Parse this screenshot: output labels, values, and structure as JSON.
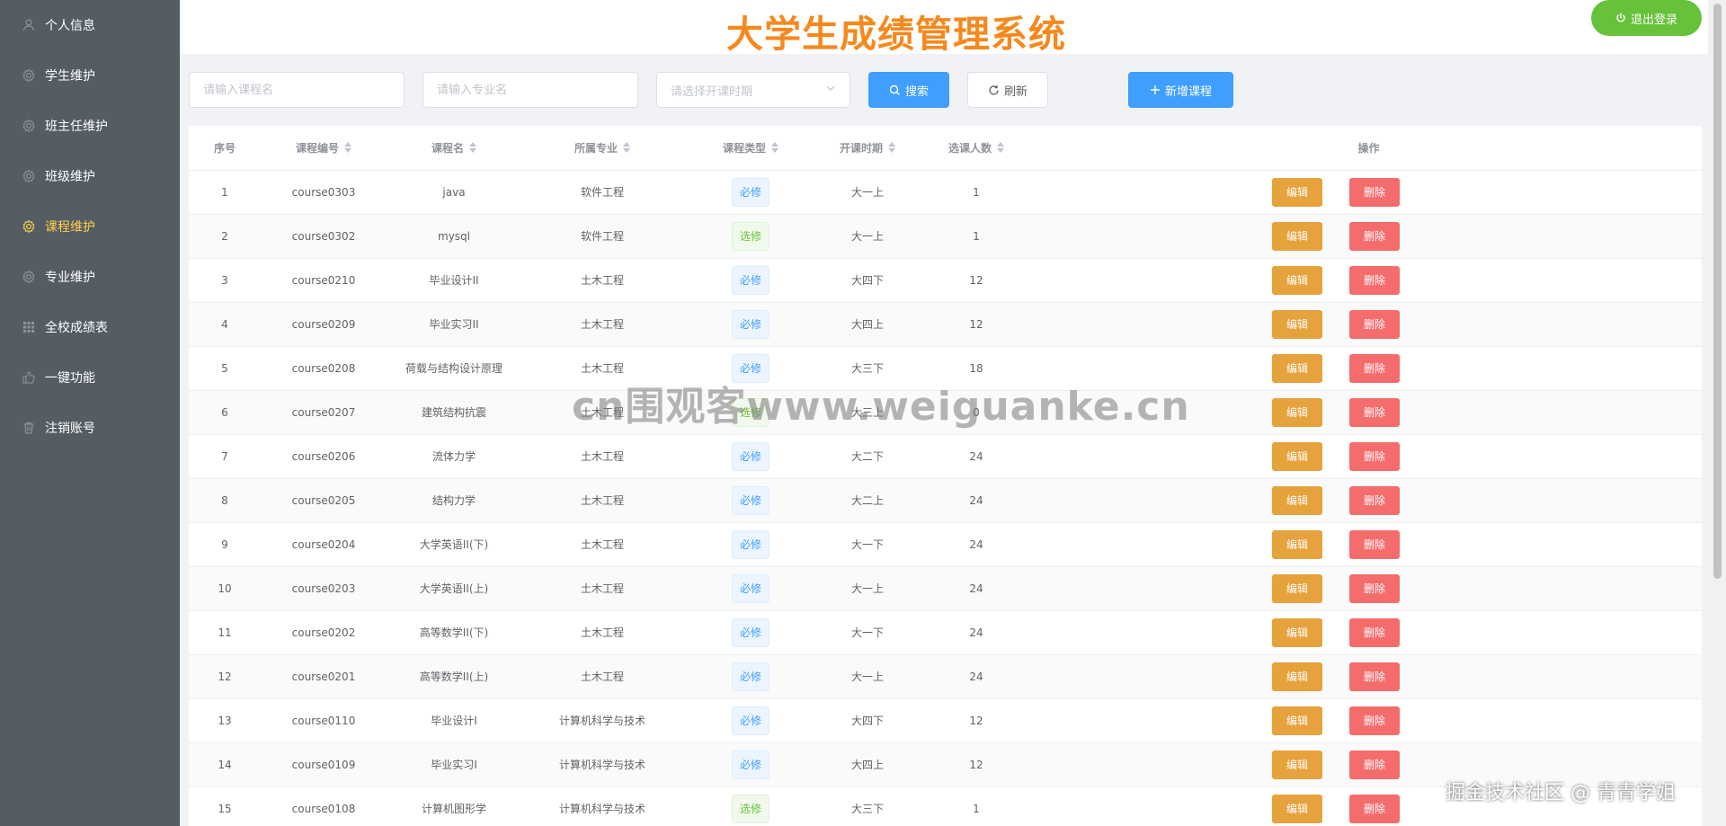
{
  "sidebar": {
    "items": [
      {
        "label": "个人信息",
        "icon": "user-icon"
      },
      {
        "label": "学生维护",
        "icon": "gear-icon"
      },
      {
        "label": "班主任维护",
        "icon": "gear-icon"
      },
      {
        "label": "班级维护",
        "icon": "gear-icon"
      },
      {
        "label": "课程维护",
        "icon": "gear-icon",
        "active": true
      },
      {
        "label": "专业维护",
        "icon": "gear-icon"
      },
      {
        "label": "全校成绩表",
        "icon": "grid-icon"
      },
      {
        "label": "一键功能",
        "icon": "thumb-icon"
      },
      {
        "label": "注销账号",
        "icon": "trash-icon"
      }
    ]
  },
  "header": {
    "title": "大学生成绩管理系统",
    "logout_label": "退出登录"
  },
  "toolbar": {
    "course_placeholder": "请输入课程名",
    "major_placeholder": "请输入专业名",
    "period_placeholder": "请选择开课时期",
    "search_label": "搜索",
    "refresh_label": "刷新",
    "add_label": "新增课程"
  },
  "table": {
    "headers": [
      "序号",
      "课程编号",
      "课程名",
      "所属专业",
      "课程类型",
      "开课时期",
      "选课人数",
      "操作"
    ],
    "edit_label": "编辑",
    "delete_label": "删除",
    "rows": [
      {
        "no": "1",
        "code": "course0303",
        "name": "java",
        "major": "软件工程",
        "type": "必修",
        "period": "大一上",
        "count": "1"
      },
      {
        "no": "2",
        "code": "course0302",
        "name": "mysql",
        "major": "软件工程",
        "type": "选修",
        "period": "大一上",
        "count": "1"
      },
      {
        "no": "3",
        "code": "course0210",
        "name": "毕业设计II",
        "major": "土木工程",
        "type": "必修",
        "period": "大四下",
        "count": "12"
      },
      {
        "no": "4",
        "code": "course0209",
        "name": "毕业实习II",
        "major": "土木工程",
        "type": "必修",
        "period": "大四上",
        "count": "12"
      },
      {
        "no": "5",
        "code": "course0208",
        "name": "荷载与结构设计原理",
        "major": "土木工程",
        "type": "必修",
        "period": "大三下",
        "count": "18"
      },
      {
        "no": "6",
        "code": "course0207",
        "name": "建筑结构抗震",
        "major": "土木工程",
        "type": "选修",
        "period": "大三上",
        "count": "0"
      },
      {
        "no": "7",
        "code": "course0206",
        "name": "流体力学",
        "major": "土木工程",
        "type": "必修",
        "period": "大二下",
        "count": "24"
      },
      {
        "no": "8",
        "code": "course0205",
        "name": "结构力学",
        "major": "土木工程",
        "type": "必修",
        "period": "大二上",
        "count": "24"
      },
      {
        "no": "9",
        "code": "course0204",
        "name": "大学英语II(下)",
        "major": "土木工程",
        "type": "必修",
        "period": "大一下",
        "count": "24"
      },
      {
        "no": "10",
        "code": "course0203",
        "name": "大学英语II(上)",
        "major": "土木工程",
        "type": "必修",
        "period": "大一上",
        "count": "24"
      },
      {
        "no": "11",
        "code": "course0202",
        "name": "高等数学II(下)",
        "major": "土木工程",
        "type": "必修",
        "period": "大一下",
        "count": "24"
      },
      {
        "no": "12",
        "code": "course0201",
        "name": "高等数学II(上)",
        "major": "土木工程",
        "type": "必修",
        "period": "大一上",
        "count": "24"
      },
      {
        "no": "13",
        "code": "course0110",
        "name": "毕业设计I",
        "major": "计算机科学与技术",
        "type": "必修",
        "period": "大四下",
        "count": "12"
      },
      {
        "no": "14",
        "code": "course0109",
        "name": "毕业实习I",
        "major": "计算机科学与技术",
        "type": "必修",
        "period": "大四上",
        "count": "12"
      },
      {
        "no": "15",
        "code": "course0108",
        "name": "计算机图形学",
        "major": "计算机科学与技术",
        "type": "选修",
        "period": "大三下",
        "count": "1"
      }
    ]
  },
  "watermarks": {
    "center": "cn围观客www.weiguanke.cn",
    "corner": "掘金技术社区 @ 青青学姐"
  },
  "colors": {
    "sidebar_bg": "#545c64",
    "active_menu": "#ffd04b",
    "title": "#f5891e",
    "primary": "#409eff",
    "success": "#67c23a",
    "warning": "#e6a23c",
    "danger": "#f56c6c"
  }
}
